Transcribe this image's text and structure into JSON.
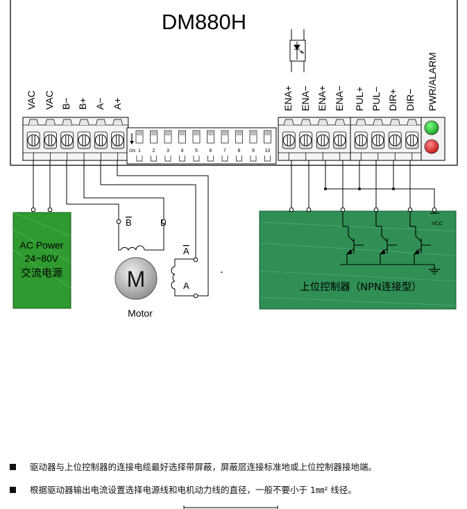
{
  "title": "DM880H",
  "terminals_left": [
    "VAC",
    "VAC",
    "B−",
    "B+",
    "A−",
    "A+"
  ],
  "terminals_ena": [
    "ENA+",
    "ENA−",
    "ENA+",
    "ENA−"
  ],
  "terminals_sig": [
    "PUL+",
    "PUL−",
    "DIR+",
    "DIR−"
  ],
  "status_label": "PWR/ALARM",
  "dip": {
    "on_label": "ON",
    "numbers": [
      "1",
      "2",
      "3",
      "4",
      "5",
      "6",
      "7",
      "8",
      "9",
      "10"
    ]
  },
  "power_box": {
    "line1": "AC Power",
    "line2": "24~80V",
    "line3": "交流电源"
  },
  "motor": {
    "letter": "M",
    "label": "Motor",
    "coil_b_bar": "B",
    "coil_b": "B",
    "coil_a_bar": "A",
    "coil_a": "A"
  },
  "controller": {
    "label": "上位控制器（NPN连接型）",
    "vcc": "VCC"
  },
  "colors": {
    "power_green": "#2f9a2f",
    "controller_green": "#2f8f55",
    "led_green": "#19c21f",
    "led_red": "#e52020"
  },
  "notes": [
    "驱动器与上位控制器的连接电缆最好选择带屏蔽，屏蔽层连接标准地或上位控制器接地端。",
    "根据驱动器输出电流设置选择电源线和电机动力线的直径，一般不要小于 1㎜² 线径。"
  ]
}
